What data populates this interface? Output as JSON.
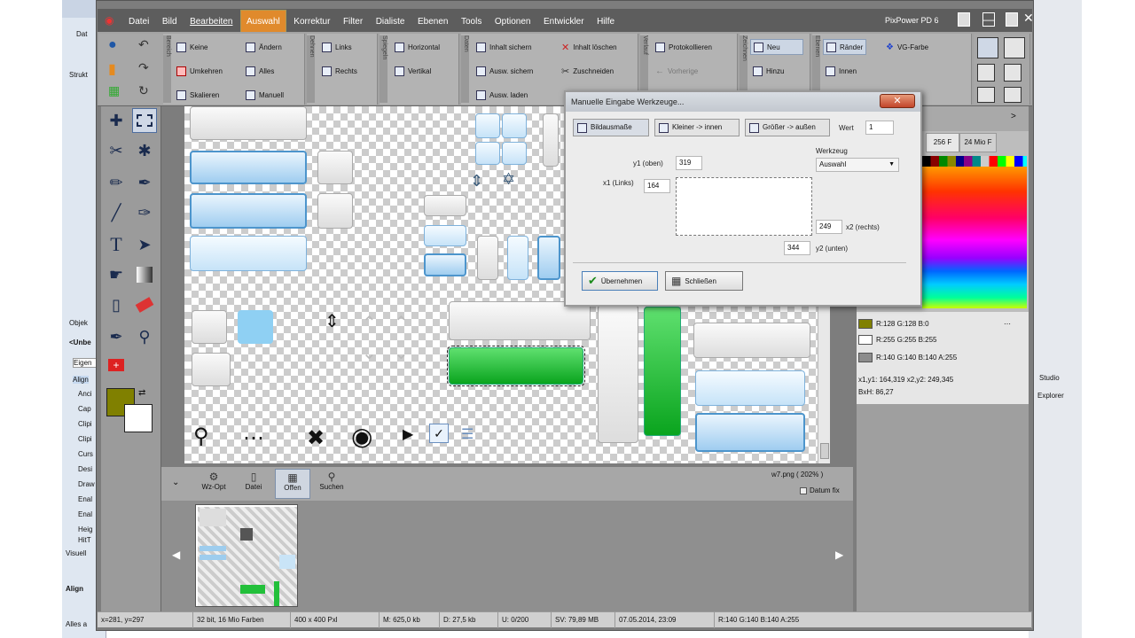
{
  "window": {
    "title": "PixPower PD 6"
  },
  "left_bg": {
    "labels": [
      "Dat",
      "Strukt",
      "Objek",
      "<Unbe",
      "Eigen",
      "Align",
      "Anci",
      "Cap",
      "Clipi",
      "Clipi",
      "Curs",
      "Desi",
      "Draw",
      "Enal",
      "Enal",
      "Heig",
      "HitT",
      "Visuell",
      "Align",
      "Alles a"
    ]
  },
  "right_bg": {
    "labels": [
      "Studio",
      "Explorer"
    ]
  },
  "menu": {
    "items": [
      "Datei",
      "Bild",
      "Bearbeiten",
      "Auswahl",
      "Korrektur",
      "Filter",
      "Dialiste",
      "Ebenen",
      "Tools",
      "Optionen",
      "Entwickler",
      "Hilfe"
    ],
    "active": "Auswahl"
  },
  "ribbon": {
    "groups": [
      "Bereich",
      "Ändern",
      "Dehnen",
      "Spiegeln",
      "Daten",
      "Verlauf",
      "Zeichnen",
      "Ebenen"
    ],
    "sel_buttons": [
      "Keine",
      "Umkehren",
      "Skalieren"
    ],
    "mod_buttons": [
      "Ändern",
      "Alles",
      "Manuell"
    ],
    "stretch_buttons": [
      "Links",
      "Rechts"
    ],
    "mirror_buttons": [
      "Horizontal",
      "Vertikal"
    ],
    "data_buttons": [
      "Inhalt sichern",
      "Ausw. sichern",
      "Ausw. laden"
    ],
    "data2_buttons": [
      "Inhalt löschen",
      "Zuschneiden"
    ],
    "history_buttons": [
      "Protokollieren",
      "Vorherige"
    ],
    "draw_buttons": [
      "Neu",
      "Hinzu"
    ],
    "layer_buttons": [
      "Ränder",
      "Innen"
    ],
    "color_button": "VG-Farbe"
  },
  "tools": [
    "move-selection",
    "rect-select",
    "crop",
    "magic-wand",
    "brush",
    "pen",
    "line",
    "eyedropper",
    "text",
    "fill",
    "dodge",
    "gradient",
    "clone",
    "eraser",
    "color-picker",
    "zoom",
    "first-aid"
  ],
  "browser_bar": {
    "buttons": [
      "Wz-Opt",
      "Datei",
      "Offen",
      "Suchen"
    ],
    "filename": "w7.png  ( 202% )",
    "checkbox_label": "Datum fix"
  },
  "status": [
    "x=281, y=297",
    "32 bit, 16 Mio Farben",
    "400 x 400 Pxl",
    "M: 625,0 kb",
    "D:  27,5 kb",
    "U: 0/200",
    "SV:  79,89 MB",
    "07.05.2014, 23:09",
    "R:140  G:140  B:140  A:255"
  ],
  "palette": {
    "tabs": [
      "256 F",
      "24 Mio F"
    ],
    "swatches": [
      {
        "color": "#808000",
        "label": "R:128 G:128 B:0"
      },
      {
        "color": "#ffffff",
        "label": "R:255 G:255 B:255"
      },
      {
        "color": "#8c8c8c",
        "label": "R:140  G:140  B:140  A:255"
      }
    ],
    "coords": "x1,y1: 164,319  x2,y2: 249,345",
    "bxh": "BxH:  86,27"
  },
  "dialog": {
    "title": "Manuelle Eingabe Werkzeuge...",
    "tabs": [
      "Bildausmaße",
      "Kleiner -> innen",
      "Größer -> außen"
    ],
    "wert_label": "Wert",
    "wert_value": "1",
    "y1_label": "y1 (oben)",
    "y1_value": "319",
    "x1_label": "x1 (Links)",
    "x1_value": "164",
    "x2_label": "x2 (rechts)",
    "x2_value": "249",
    "y2_label": "y2 (unten)",
    "y2_value": "344",
    "werkzeug_label": "Werkzeug",
    "werkzeug_value": "Auswahl",
    "ok_label": "Übernehmen",
    "close_label": "Schließen"
  }
}
